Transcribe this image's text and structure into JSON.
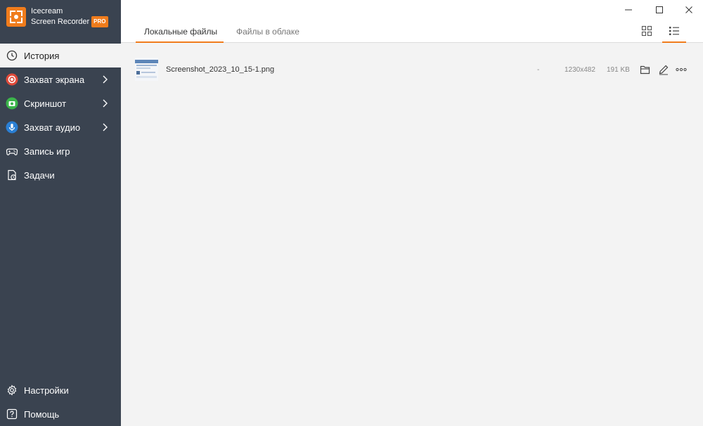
{
  "app": {
    "name_line1": "Icecream",
    "name_line2": "Screen Recorder",
    "badge": "PRO",
    "accent": "#f07c1c"
  },
  "sidebar": {
    "items": [
      {
        "label": "История",
        "icon": "clock-icon",
        "active": true
      },
      {
        "label": "Захват экрана",
        "icon": "record-icon",
        "color": "#e04a3a",
        "has_submenu": true
      },
      {
        "label": "Скриншот",
        "icon": "camera-icon",
        "color": "#3bb54a",
        "has_submenu": true
      },
      {
        "label": "Захват аудио",
        "icon": "microphone-icon",
        "color": "#2a7fd4",
        "has_submenu": true
      },
      {
        "label": "Запись игр",
        "icon": "gamepad-icon"
      },
      {
        "label": "Задачи",
        "icon": "tasks-icon"
      }
    ],
    "bottom": [
      {
        "label": "Настройки",
        "icon": "gear-icon"
      },
      {
        "label": "Помощь",
        "icon": "help-icon"
      }
    ]
  },
  "tabs": [
    {
      "label": "Локальные файлы",
      "active": true
    },
    {
      "label": "Файлы в облаке",
      "active": false
    }
  ],
  "files": [
    {
      "name": "Screenshot_2023_10_15-1.png",
      "duration": "-",
      "resolution": "1230x482",
      "size": "191 KB"
    }
  ]
}
